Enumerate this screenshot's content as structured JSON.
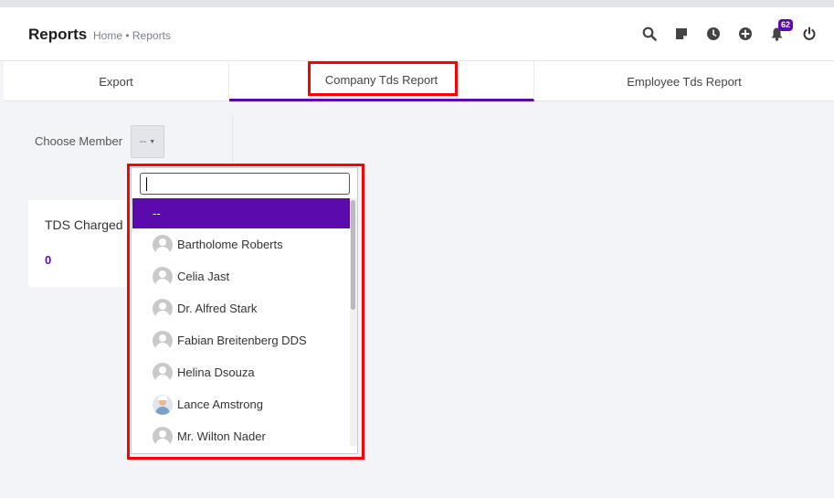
{
  "header": {
    "title": "Reports",
    "breadcrumb": "Home • Reports",
    "notification_count": "62",
    "icons": [
      "search-icon",
      "sticky-note-icon",
      "clock-icon",
      "add-circle-icon",
      "bell-icon",
      "power-icon"
    ]
  },
  "tabs": [
    {
      "label": "Export"
    },
    {
      "label": "Company Tds Report"
    },
    {
      "label": "Employee Tds Report"
    }
  ],
  "filter": {
    "label": "Choose Member",
    "selected": "--"
  },
  "card": {
    "title": "TDS Charged",
    "value": "0"
  },
  "dropdown": {
    "search_value": "",
    "options": [
      {
        "label": "--"
      },
      {
        "label": "Bartholome Roberts"
      },
      {
        "label": "Celia Jast"
      },
      {
        "label": "Dr. Alfred Stark"
      },
      {
        "label": "Fabian Breitenberg DDS"
      },
      {
        "label": "Helina Dsouza"
      },
      {
        "label": "Lance Amstrong"
      },
      {
        "label": "Mr. Wilton Nader"
      }
    ]
  },
  "colors": {
    "accent": "#5b0bad",
    "highlight": "#ff0000"
  }
}
